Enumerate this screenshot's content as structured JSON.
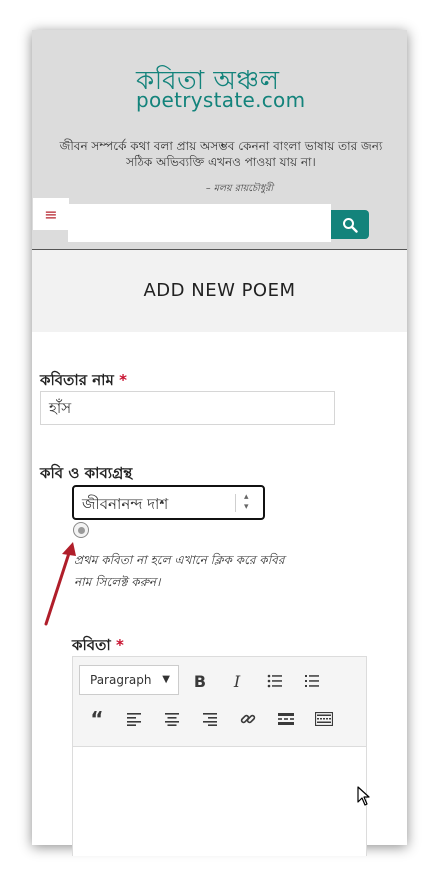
{
  "site": {
    "logo_bengali": "কবিতা অঞ্চল",
    "logo_english": "poetrystate.com",
    "quote": "জীবন সম্পর্কে কথা বলা প্রায় অসম্ভব কেননা বাংলা ভাষায় তার জন্য সঠিক অভিব্যক্তি এখনও পাওয়া যায় না।",
    "quote_author": "– মলয় রায়চৌধুরী",
    "menu_icon": "≡",
    "search_placeholder": ""
  },
  "page": {
    "title": "ADD NEW POEM"
  },
  "form": {
    "poem_name_label": "কবিতার নাম",
    "required_mark": "*",
    "poem_name_value": "হাঁস",
    "poet_label": "কবি ও কাব্যগ্রন্থ",
    "poet_selected": "জীবনানন্দ দাশ",
    "hint": "প্রথম কবিতা না হলে এখানে ক্লিক করে কবির নাম সিলেক্ট করুন।",
    "poem_label": "কবিতা"
  },
  "editor": {
    "format_select": "Paragraph",
    "tools_row1": [
      "bold-icon",
      "italic-icon",
      "bullet-list-icon",
      "numbered-list-icon"
    ],
    "tools_row2": [
      "blockquote-icon",
      "align-left-icon",
      "align-center-icon",
      "align-right-icon",
      "link-icon",
      "read-more-icon",
      "toolbar-toggle-icon"
    ]
  },
  "colors": {
    "brand": "#13837b",
    "required": "#c8102e",
    "menu": "#b5222c",
    "arrow": "#b01e2a"
  }
}
